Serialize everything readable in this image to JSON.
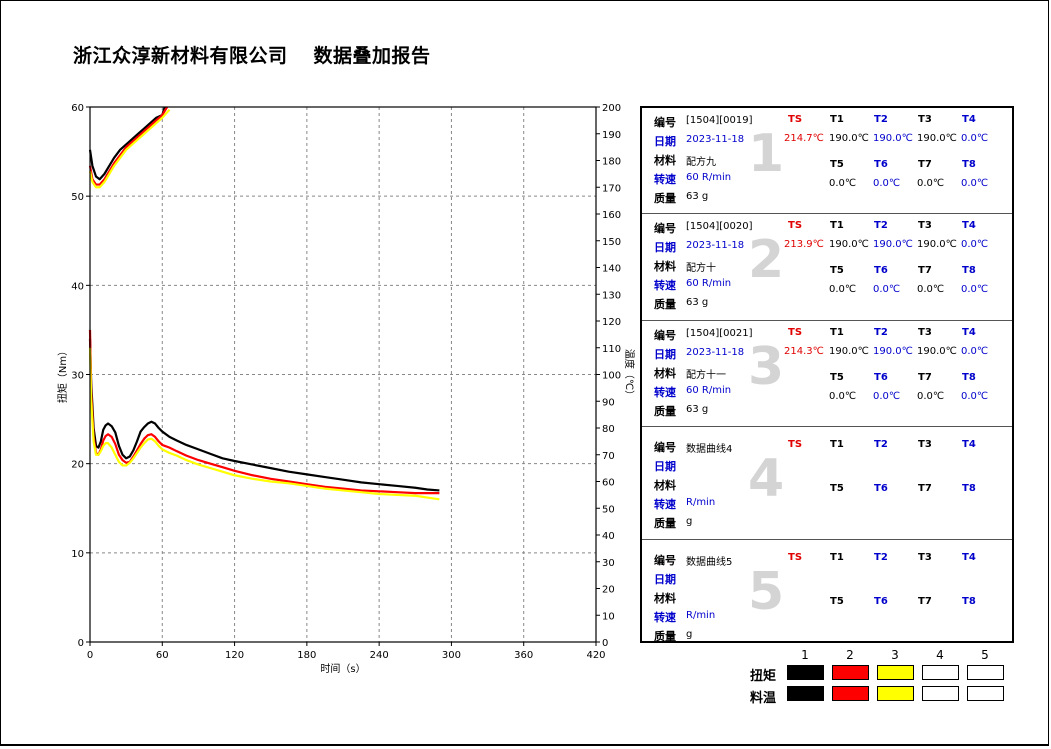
{
  "header": {
    "company": "浙江众淳新材料有限公司",
    "report_title": "数据叠加报告"
  },
  "labels": {
    "id": "编号",
    "date": "日期",
    "material": "材料",
    "speed": "转速",
    "mass": "质量",
    "torque": "扭矩",
    "melt_temp": "料温"
  },
  "colors": {
    "series1": "#000000",
    "series2": "#ff0000",
    "series3": "#ffff00",
    "blue_text": "#0000cc",
    "red_text": "#e00000"
  },
  "cards": [
    {
      "num": "1",
      "id": "[1504][0019]",
      "date": "2023-11-18",
      "material": "配方九",
      "speed": "60 R/min",
      "mass": "63 g",
      "ts": "214.7℃",
      "t1": "190.0℃",
      "t2": "190.0℃",
      "t3": "190.0℃",
      "t4": "0.0℃",
      "t5": "0.0℃",
      "t6": "0.0℃",
      "t7": "0.0℃",
      "t8": "0.0℃"
    },
    {
      "num": "2",
      "id": "[1504][0020]",
      "date": "2023-11-18",
      "material": "配方十",
      "speed": "60 R/min",
      "mass": "63 g",
      "ts": "213.9℃",
      "t1": "190.0℃",
      "t2": "190.0℃",
      "t3": "190.0℃",
      "t4": "0.0℃",
      "t5": "0.0℃",
      "t6": "0.0℃",
      "t7": "0.0℃",
      "t8": "0.0℃"
    },
    {
      "num": "3",
      "id": "[1504][0021]",
      "date": "2023-11-18",
      "material": "配方十一",
      "speed": "60 R/min",
      "mass": "63 g",
      "ts": "214.3℃",
      "t1": "190.0℃",
      "t2": "190.0℃",
      "t3": "190.0℃",
      "t4": "0.0℃",
      "t5": "0.0℃",
      "t6": "0.0℃",
      "t7": "0.0℃",
      "t8": "0.0℃"
    },
    {
      "num": "4",
      "id": "数据曲线4",
      "date": "",
      "material": "",
      "speed": "R/min",
      "mass": "g",
      "ts": "",
      "t1": "",
      "t2": "",
      "t3": "",
      "t4": "",
      "t5": "",
      "t6": "",
      "t7": "",
      "t8": ""
    },
    {
      "num": "5",
      "id": "数据曲线5",
      "date": "",
      "material": "",
      "speed": "R/min",
      "mass": "g",
      "ts": "",
      "t1": "",
      "t2": "",
      "t3": "",
      "t4": "",
      "t5": "",
      "t6": "",
      "t7": "",
      "t8": ""
    }
  ],
  "temp_headers": {
    "ts": "TS",
    "t1": "T1",
    "t2": "T2",
    "t3": "T3",
    "t4": "T4",
    "t5": "T5",
    "t6": "T6",
    "t7": "T7",
    "t8": "T8"
  },
  "legend": {
    "columns": [
      "1",
      "2",
      "3",
      "4",
      "5"
    ],
    "swatch_colors": [
      "#000000",
      "#ff0000",
      "#ffff00",
      "#ffffff",
      "#ffffff"
    ]
  },
  "chart_data": {
    "type": "line",
    "xlabel": "时间（s）",
    "ylabel": "扭矩（Nm）",
    "y2label": "温度（℃）",
    "xlim": [
      0,
      420
    ],
    "ylim": [
      0,
      60
    ],
    "y2lim": [
      0,
      200
    ],
    "xticks": [
      0,
      60,
      120,
      180,
      240,
      300,
      360,
      420
    ],
    "yticks": [
      0,
      10,
      20,
      30,
      40,
      50,
      60
    ],
    "y2ticks": [
      0,
      10,
      20,
      30,
      40,
      50,
      60,
      70,
      80,
      90,
      100,
      110,
      120,
      130,
      140,
      150,
      160,
      170,
      180,
      190,
      200
    ],
    "grid": true,
    "series": [
      {
        "name": "1",
        "color": "#000000",
        "torque": [
          [
            0,
            34
          ],
          [
            1,
            29
          ],
          [
            3,
            24
          ],
          [
            5,
            22
          ],
          [
            7,
            21.8
          ],
          [
            9,
            22.5
          ],
          [
            11,
            23.8
          ],
          [
            13,
            24.3
          ],
          [
            15,
            24.5
          ],
          [
            18,
            24.2
          ],
          [
            21,
            23.5
          ],
          [
            24,
            22
          ],
          [
            27,
            21
          ],
          [
            30,
            20.6
          ],
          [
            33,
            20.8
          ],
          [
            36,
            21.5
          ],
          [
            39,
            22.5
          ],
          [
            42,
            23.6
          ],
          [
            45,
            24.1
          ],
          [
            48,
            24.5
          ],
          [
            51,
            24.7
          ],
          [
            54,
            24.5
          ],
          [
            57,
            24
          ],
          [
            60,
            23.6
          ],
          [
            66,
            23
          ],
          [
            72,
            22.6
          ],
          [
            80,
            22.1
          ],
          [
            90,
            21.6
          ],
          [
            100,
            21.1
          ],
          [
            110,
            20.6
          ],
          [
            120,
            20.3
          ],
          [
            135,
            19.9
          ],
          [
            150,
            19.5
          ],
          [
            165,
            19.1
          ],
          [
            180,
            18.8
          ],
          [
            195,
            18.5
          ],
          [
            210,
            18.2
          ],
          [
            225,
            17.9
          ],
          [
            240,
            17.7
          ],
          [
            255,
            17.5
          ],
          [
            270,
            17.3
          ],
          [
            280,
            17.1
          ],
          [
            290,
            17
          ]
        ],
        "temp": [
          [
            0,
            184
          ],
          [
            2,
            178
          ],
          [
            5,
            174
          ],
          [
            8,
            173
          ],
          [
            12,
            175
          ],
          [
            16,
            178
          ],
          [
            20,
            181
          ],
          [
            25,
            184
          ],
          [
            30,
            186
          ],
          [
            35,
            188
          ],
          [
            40,
            190
          ],
          [
            45,
            192
          ],
          [
            50,
            194
          ],
          [
            55,
            196
          ],
          [
            60,
            197
          ],
          [
            62,
            200
          ]
        ]
      },
      {
        "name": "2",
        "color": "#ff0000",
        "torque": [
          [
            0,
            35
          ],
          [
            1,
            28
          ],
          [
            3,
            23
          ],
          [
            5,
            21.2
          ],
          [
            7,
            21
          ],
          [
            9,
            21.6
          ],
          [
            11,
            22.6
          ],
          [
            13,
            23.1
          ],
          [
            15,
            23.3
          ],
          [
            18,
            23
          ],
          [
            21,
            22.2
          ],
          [
            24,
            21
          ],
          [
            27,
            20.4
          ],
          [
            30,
            20.1
          ],
          [
            33,
            20.2
          ],
          [
            36,
            20.8
          ],
          [
            39,
            21.5
          ],
          [
            42,
            22.2
          ],
          [
            45,
            22.8
          ],
          [
            48,
            23.2
          ],
          [
            51,
            23.3
          ],
          [
            54,
            23
          ],
          [
            57,
            22.5
          ],
          [
            60,
            22.1
          ],
          [
            66,
            21.8
          ],
          [
            72,
            21.4
          ],
          [
            80,
            20.9
          ],
          [
            90,
            20.4
          ],
          [
            100,
            20
          ],
          [
            110,
            19.6
          ],
          [
            120,
            19.2
          ],
          [
            135,
            18.7
          ],
          [
            150,
            18.3
          ],
          [
            165,
            18
          ],
          [
            180,
            17.7
          ],
          [
            195,
            17.4
          ],
          [
            210,
            17.2
          ],
          [
            225,
            17
          ],
          [
            240,
            16.9
          ],
          [
            255,
            16.8
          ],
          [
            270,
            16.7
          ],
          [
            280,
            16.7
          ],
          [
            290,
            16.7
          ]
        ],
        "temp": [
          [
            0,
            178
          ],
          [
            2,
            173
          ],
          [
            5,
            171
          ],
          [
            8,
            171
          ],
          [
            12,
            173
          ],
          [
            16,
            176
          ],
          [
            20,
            179
          ],
          [
            25,
            182
          ],
          [
            30,
            185
          ],
          [
            35,
            187
          ],
          [
            40,
            189
          ],
          [
            45,
            191
          ],
          [
            50,
            193
          ],
          [
            55,
            195
          ],
          [
            60,
            197
          ],
          [
            64,
            200
          ]
        ]
      },
      {
        "name": "3",
        "color": "#ffff00",
        "torque": [
          [
            0,
            33
          ],
          [
            1,
            27
          ],
          [
            3,
            22.5
          ],
          [
            5,
            21
          ],
          [
            7,
            21
          ],
          [
            9,
            21.4
          ],
          [
            11,
            22
          ],
          [
            13,
            22.3
          ],
          [
            15,
            22.3
          ],
          [
            18,
            21.8
          ],
          [
            21,
            21
          ],
          [
            24,
            20.2
          ],
          [
            27,
            19.8
          ],
          [
            30,
            19.8
          ],
          [
            33,
            20.1
          ],
          [
            36,
            20.6
          ],
          [
            39,
            21.2
          ],
          [
            42,
            21.8
          ],
          [
            45,
            22.3
          ],
          [
            48,
            22.7
          ],
          [
            51,
            22.8
          ],
          [
            54,
            22.5
          ],
          [
            57,
            22
          ],
          [
            60,
            21.6
          ],
          [
            66,
            21.2
          ],
          [
            72,
            20.9
          ],
          [
            80,
            20.4
          ],
          [
            90,
            19.9
          ],
          [
            100,
            19.5
          ],
          [
            110,
            19.1
          ],
          [
            120,
            18.7
          ],
          [
            135,
            18.3
          ],
          [
            150,
            18
          ],
          [
            165,
            17.8
          ],
          [
            180,
            17.5
          ],
          [
            195,
            17.2
          ],
          [
            210,
            17
          ],
          [
            225,
            16.8
          ],
          [
            240,
            16.6
          ],
          [
            255,
            16.5
          ],
          [
            270,
            16.4
          ],
          [
            280,
            16.2
          ],
          [
            290,
            16
          ]
        ],
        "temp": [
          [
            0,
            176
          ],
          [
            2,
            172
          ],
          [
            5,
            170
          ],
          [
            8,
            170
          ],
          [
            12,
            172
          ],
          [
            16,
            175
          ],
          [
            20,
            178
          ],
          [
            25,
            181
          ],
          [
            30,
            184
          ],
          [
            35,
            186
          ],
          [
            40,
            188
          ],
          [
            45,
            190
          ],
          [
            50,
            192
          ],
          [
            55,
            194
          ],
          [
            60,
            196
          ],
          [
            66,
            199
          ]
        ]
      }
    ]
  }
}
